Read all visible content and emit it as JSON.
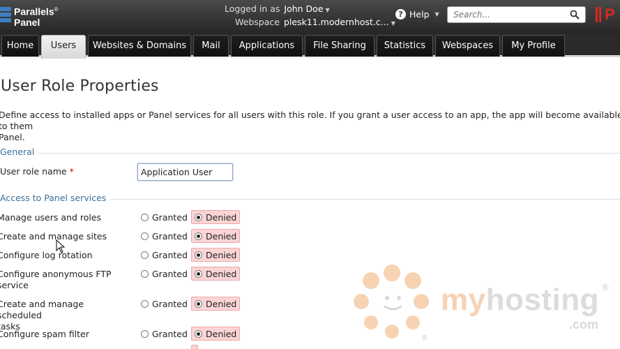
{
  "header": {
    "logo_line1": "Parallels",
    "logo_line2": "Panel",
    "logo_reg": "®",
    "logged_in_label": "Logged in as",
    "user_name": "John Doe",
    "webspace_label": "Webspace",
    "webspace_value": "plesk11.modernhost.c...",
    "help_label": "Help",
    "search_placeholder": "Search...",
    "right_logo": "P"
  },
  "nav": {
    "tabs": [
      {
        "label": "Home",
        "active": false
      },
      {
        "label": "Users",
        "active": true
      },
      {
        "label": "Websites & Domains",
        "active": false
      },
      {
        "label": "Mail",
        "active": false
      },
      {
        "label": "Applications",
        "active": false
      },
      {
        "label": "File Sharing",
        "active": false
      },
      {
        "label": "Statistics",
        "active": false
      },
      {
        "label": "Webspaces",
        "active": false
      },
      {
        "label": "My Profile",
        "active": false
      }
    ]
  },
  "page": {
    "title": "User Role Properties",
    "description_line1": "Define access to installed apps or Panel services for all users with this role. If you grant a user access to an app, the app will become available to them",
    "description_line2": "Panel."
  },
  "general": {
    "heading": "General",
    "role_name_label": "User role name",
    "required_mark": "*",
    "role_name_value": "Application User"
  },
  "access": {
    "heading": "Access to Panel services",
    "granted_label": "Granted",
    "denied_label": "Denied",
    "rows": [
      {
        "line1": "Manage users and roles",
        "line2": "",
        "value": "Denied"
      },
      {
        "line1": "Create and manage sites",
        "line2": "",
        "value": "Denied"
      },
      {
        "line1": "Configure log rotation",
        "line2": "",
        "value": "Denied"
      },
      {
        "line1": "Configure anonymous FTP",
        "line2": "service",
        "value": "Denied"
      },
      {
        "line1": "Create and manage scheduled",
        "line2": "tasks",
        "value": "Denied"
      },
      {
        "line1": "Configure spam filter",
        "line2": "",
        "value": "Denied"
      }
    ]
  },
  "watermark": {
    "part1": "my",
    "part2": "hosting",
    "suffix": ".com",
    "reg": "®"
  },
  "colors": {
    "header_bg": "#262626",
    "section_heading": "#3b6f9a",
    "denied_highlight": "#fbd5d5",
    "brand_red": "#d42b1e"
  }
}
